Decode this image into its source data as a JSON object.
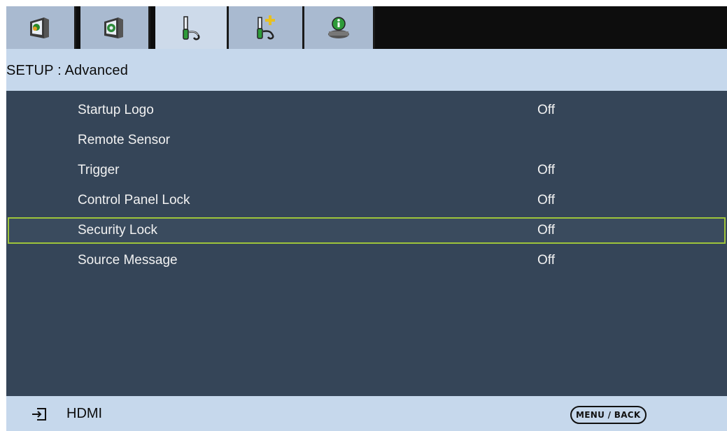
{
  "tabs": [
    {
      "icon": "picture-icon",
      "active": false
    },
    {
      "icon": "image-settings-icon",
      "active": false
    },
    {
      "icon": "setup-icon",
      "active": true
    },
    {
      "icon": "advanced-setup-icon",
      "active": false
    },
    {
      "icon": "info-icon",
      "active": false
    }
  ],
  "header": {
    "title": "SETUP : Advanced"
  },
  "menu": {
    "items": [
      {
        "label": "Startup Logo",
        "value": "Off"
      },
      {
        "label": "Remote Sensor",
        "value": ""
      },
      {
        "label": "Trigger",
        "value": "Off"
      },
      {
        "label": "Control Panel Lock",
        "value": "Off"
      },
      {
        "label": "Security Lock",
        "value": "Off"
      },
      {
        "label": "Source Message",
        "value": "Off"
      }
    ],
    "selected_index": 4
  },
  "footer": {
    "source_icon": "input-source-icon",
    "source": "HDMI",
    "hint": "MENU / BACK"
  },
  "colors": {
    "highlight": "#9ec43b",
    "list_bg": "#354558",
    "bar_bg": "#c6d8ec"
  }
}
